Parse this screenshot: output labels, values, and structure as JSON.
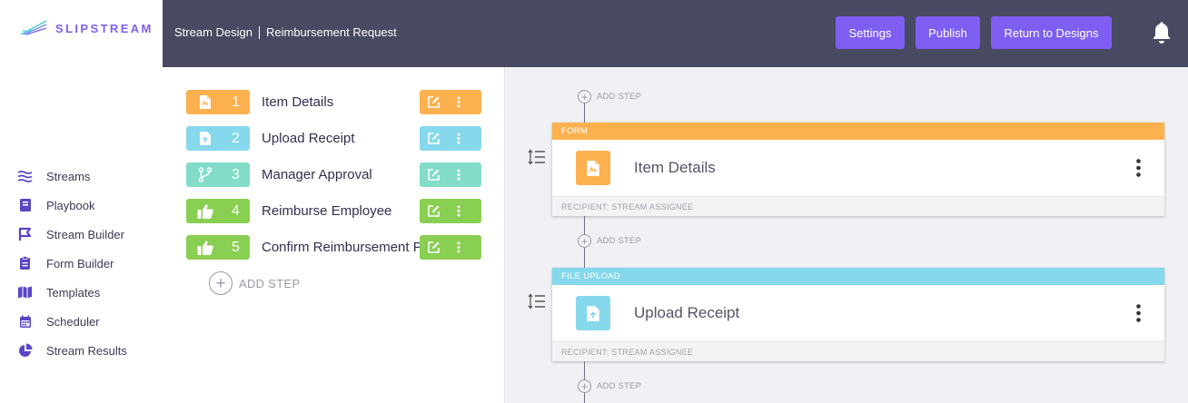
{
  "brand": {
    "name": "SLIPSTREAM",
    "accent": "#7e5ff2"
  },
  "header": {
    "breadcrumb": [
      "Stream Design",
      "Reimbursement Request"
    ],
    "buttons": {
      "settings": "Settings",
      "publish": "Publish",
      "return": "Return to Designs"
    }
  },
  "sidebar": {
    "items": [
      {
        "label": "Streams",
        "icon": "streams-icon"
      },
      {
        "label": "Playbook",
        "icon": "book-icon"
      },
      {
        "label": "Stream Builder",
        "icon": "flag-icon"
      },
      {
        "label": "Form Builder",
        "icon": "clipboard-icon"
      },
      {
        "label": "Templates",
        "icon": "map-icon"
      },
      {
        "label": "Scheduler",
        "icon": "calendar-icon"
      },
      {
        "label": "Stream Results",
        "icon": "pie-chart-icon"
      }
    ]
  },
  "steps": [
    {
      "number": "1",
      "name": "Item Details",
      "icon": "form-doc-icon",
      "color": "#fcb04e"
    },
    {
      "number": "2",
      "name": "Upload Receipt",
      "icon": "file-upload-icon",
      "color": "#86d8ec"
    },
    {
      "number": "3",
      "name": "Manager Approval",
      "icon": "branch-icon",
      "color": "#82dcc8"
    },
    {
      "number": "4",
      "name": "Reimburse Employee",
      "icon": "thumbs-up-icon",
      "color": "#89cf52"
    },
    {
      "number": "5",
      "name": "Confirm Reimbursement Payment",
      "icon": "thumbs-up-icon",
      "color": "#89cf52"
    }
  ],
  "add_step_label": "ADD STEP",
  "cards": [
    {
      "type": "FORM",
      "title": "Item Details",
      "recipient": "RECIPIENT: STREAM ASSIGNEE",
      "color": "#fcb04e"
    },
    {
      "type": "FILE UPLOAD",
      "title": "Upload Receipt",
      "recipient": "RECIPIENT: STREAM ASSIGNEE",
      "color": "#86d8ec"
    }
  ]
}
